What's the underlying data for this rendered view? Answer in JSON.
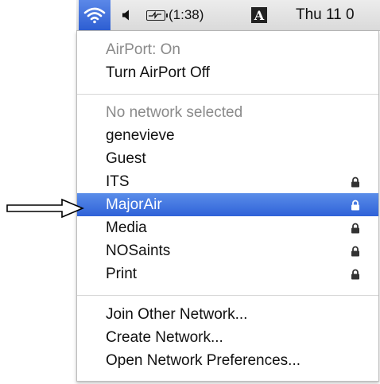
{
  "menubar": {
    "wifi_icon": "wifi-signal-icon",
    "speaker_icon": "speaker-volume-icon",
    "battery_icon": "battery-charging-icon",
    "battery_time": "(1:38)",
    "input_menu_label": "A",
    "clock": "Thu 11 0"
  },
  "menu": {
    "status": "AirPort: On",
    "toggle": "Turn AirPort Off",
    "no_network": "No network selected",
    "networks": [
      {
        "name": "genevieve",
        "locked": false
      },
      {
        "name": "Guest",
        "locked": false
      },
      {
        "name": "ITS",
        "locked": true
      },
      {
        "name": "MajorAir",
        "locked": true,
        "selected": true
      },
      {
        "name": "Media",
        "locked": true
      },
      {
        "name": "NOSaints",
        "locked": true
      },
      {
        "name": "Print",
        "locked": true
      }
    ],
    "actions": [
      "Join Other Network...",
      "Create Network...",
      "Open Network Preferences..."
    ]
  },
  "colors": {
    "highlight": "#2f62d8",
    "menubar": "#dedede",
    "disabled_text": "#8a8a8a"
  },
  "annotation_icon": "right-arrow-pointer-icon"
}
